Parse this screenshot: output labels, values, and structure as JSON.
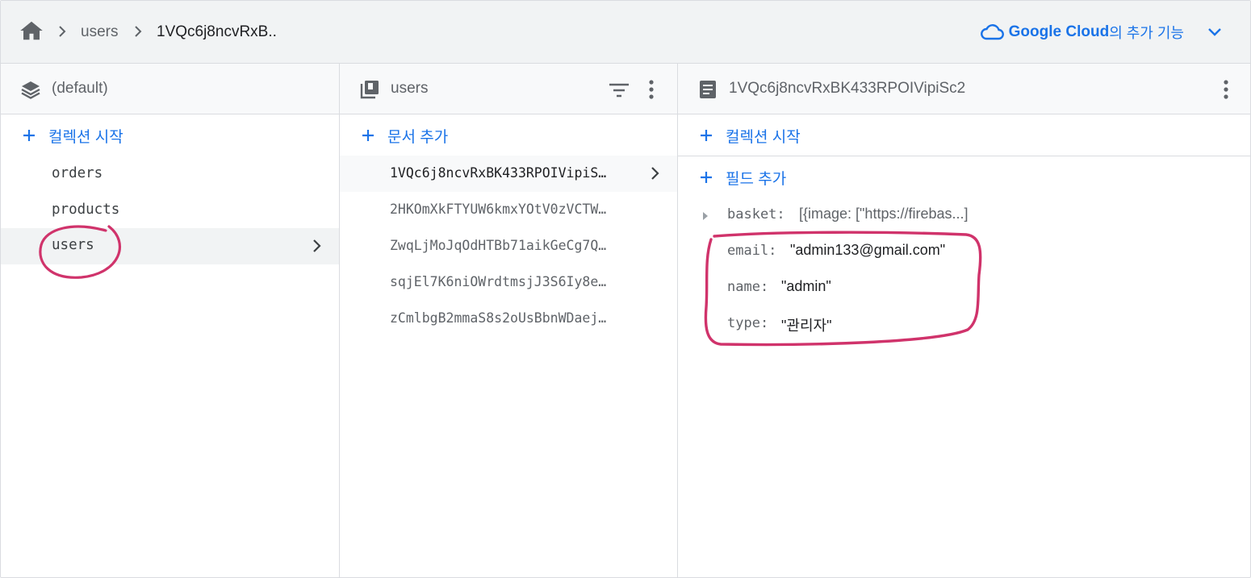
{
  "breadcrumb": {
    "items": [
      {
        "label": "users"
      },
      {
        "label": "1VQc6j8ncvRxB.."
      }
    ]
  },
  "google_cloud": {
    "brand": "Google Cloud",
    "rest": "의 추가 기능"
  },
  "panels": {
    "root": {
      "title": "(default)",
      "add_label": "컬렉션 시작",
      "items": [
        "orders",
        "products",
        "users"
      ],
      "selected": "users"
    },
    "collection": {
      "title": "users",
      "add_label": "문서 추가",
      "docs": [
        "1VQc6j8ncvRxBK433RPOIVipiSc2",
        "2HKOmXkFTYUW6kmxYOtV0zVCTW...",
        "ZwqLjMoJqOdHTBb71aikGeCg7Q...",
        "sqjEl7K6niOWrdtmsjJ3S6Iy8e...",
        "zCmlbgB2mmaS8s2oUsBbnWDaej..."
      ],
      "doc_display": [
        "1VQc6j8ncvRxBK433RPOIVipiS…",
        "2HKOmXkFTYUW6kmxYOtV0zVCTW…",
        "ZwqLjMoJqOdHTBb71aikGeCg7Q…",
        "sqjEl7K6niOWrdtmsjJ3S6Iy8e…",
        "zCmlbgB2mmaS8s2oUsBbnWDaej…"
      ]
    },
    "document": {
      "title": "1VQc6j8ncvRxBK433RPOIVipiSc2",
      "add_collection_label": "컬렉션 시작",
      "add_field_label": "필드 추가",
      "fields": [
        {
          "key": "basket:",
          "value": "[{image: [\"https://firebas...]"
        },
        {
          "key": "email:",
          "value": "\"admin133@gmail.com\""
        },
        {
          "key": "name:",
          "value": "\"admin\""
        },
        {
          "key": "type:",
          "value": "\"관리자\""
        }
      ]
    }
  },
  "colors": {
    "accent": "#1a73e8",
    "annotation": "#d0336b",
    "header_bg": "#f1f3f4"
  }
}
